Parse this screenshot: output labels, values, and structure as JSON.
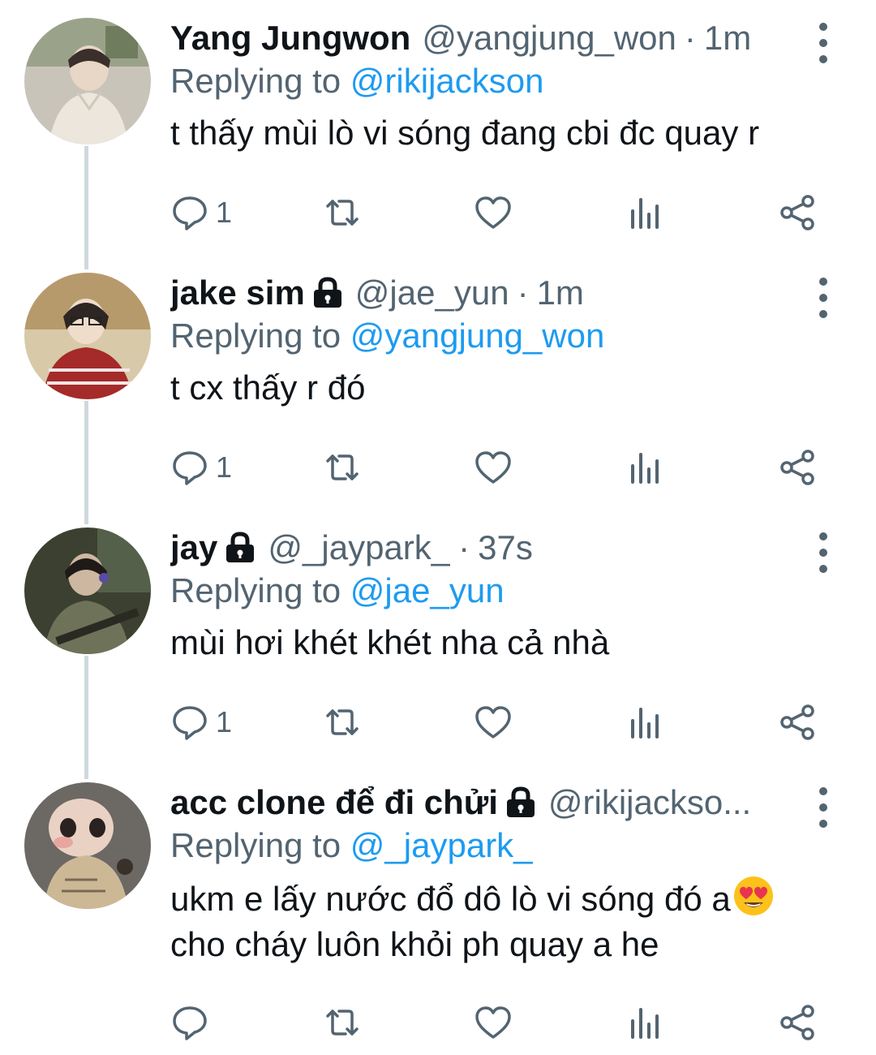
{
  "tweets": [
    {
      "name": "Yang Jungwon",
      "handle": "@yangjung_won",
      "protected": false,
      "time": "1m",
      "replying_prefix": "Replying to",
      "replying_to": "@rikijackson",
      "text": "t thấy mùi lò vi sóng đang cbi đc quay r",
      "reply_count": "1"
    },
    {
      "name": "jake sim",
      "handle": "@jae_yun",
      "protected": true,
      "time": "1m",
      "replying_prefix": "Replying to",
      "replying_to": "@yangjung_won",
      "text": "t cx thấy r đó",
      "reply_count": "1"
    },
    {
      "name": "jay",
      "handle": "@_jaypark_",
      "protected": true,
      "time": "37s",
      "replying_prefix": "Replying to",
      "replying_to": "@jae_yun",
      "text": "mùi hơi khét khét nha cả nhà",
      "reply_count": "1"
    },
    {
      "name": "acc clone để đi chửi",
      "handle": "@rikijackso...",
      "protected": true,
      "time": "",
      "replying_prefix": "Replying to",
      "replying_to": "@_jaypark_",
      "text_line1": "ukm e lấy nước đổ dô lò vi sóng đó a",
      "text_line2": "cho cháy luôn khỏi ph quay a he",
      "emoji": "smiling-face-with-heart-eyes",
      "reply_count": ""
    }
  ],
  "icons": {
    "reply": "reply-icon",
    "retweet": "retweet-icon",
    "like": "like-icon",
    "analytics": "analytics-icon",
    "share": "share-icon",
    "lock": "lock-icon",
    "more": "more-icon"
  },
  "colors": {
    "text": "#0f1419",
    "secondary": "#536471",
    "link": "#1d9bf0",
    "thread_line": "#cfd9de"
  }
}
